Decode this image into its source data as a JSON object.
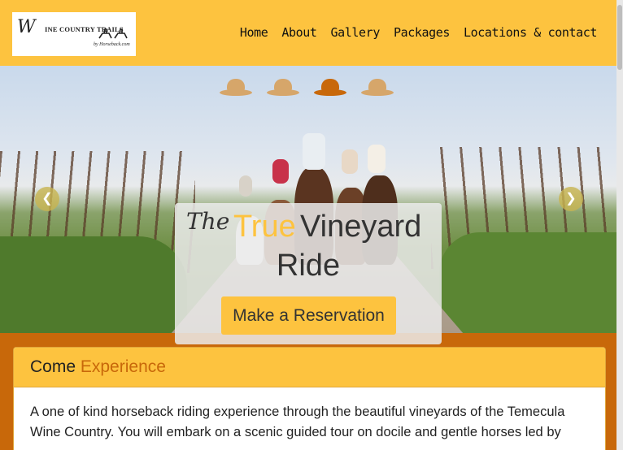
{
  "logo": {
    "script": "W",
    "text": "INE COUNTRY TRAILS",
    "sub": "by Horseback.com"
  },
  "nav": {
    "items": [
      "Home",
      "About",
      "Gallery",
      "Packages",
      "Locations & contact"
    ]
  },
  "hero": {
    "slides": 4,
    "active_slide": 3,
    "prev_glyph": "❮",
    "next_glyph": "❯",
    "caption": {
      "the": "The",
      "true": "True",
      "vineyard": "Vineyard",
      "ride": "Ride",
      "button": "Make a Reservation"
    }
  },
  "panel": {
    "heading_plain": "Come ",
    "heading_accent": "Experience",
    "body": "A one of kind horseback riding experience through the beautiful vineyards of the Temecula Wine Country. You will embark on a scenic guided tour on docile and gentle horses led by"
  },
  "colors": {
    "brand_yellow": "#fdc33f",
    "brand_orange": "#c8680a"
  }
}
